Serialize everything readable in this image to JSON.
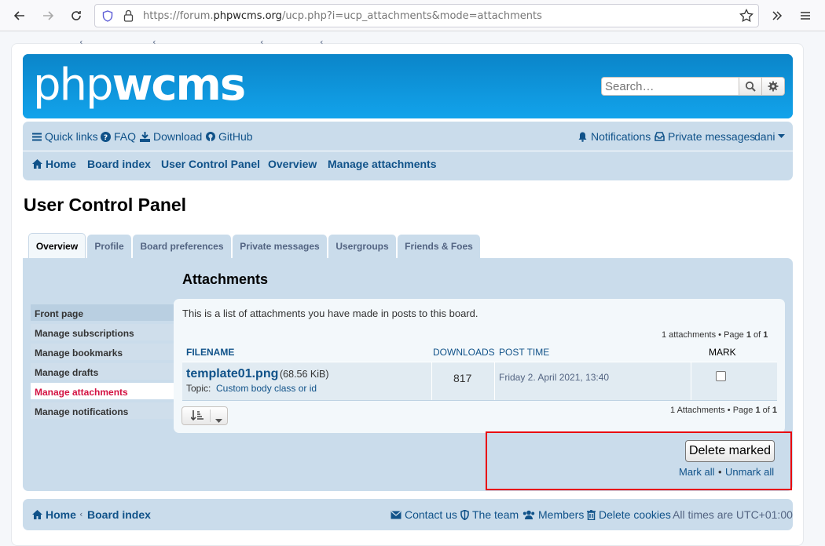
{
  "browser": {
    "url_prefix": "https://forum.",
    "url_domain": "phpwcms.org",
    "url_path": "/ucp.php?i=ucp_attachments&mode=attachments"
  },
  "header": {
    "logo_thin": "php",
    "logo_bold": "wcms",
    "search_placeholder": "Search…"
  },
  "navbar": {
    "quick_links": "Quick links",
    "faq": "FAQ",
    "download": "Download",
    "github": "GitHub",
    "notifications": "Notifications",
    "private_messages": "Private messages",
    "user": "dani",
    "breadcrumbs": [
      "Home",
      "Board index",
      "User Control Panel",
      "Overview",
      "Manage attachments"
    ]
  },
  "page_title": "User Control Panel",
  "tabs": [
    "Overview",
    "Profile",
    "Board preferences",
    "Private messages",
    "Usergroups",
    "Friends & Foes"
  ],
  "sidebar": [
    "Front page",
    "Manage subscriptions",
    "Manage bookmarks",
    "Manage drafts",
    "Manage attachments",
    "Manage notifications"
  ],
  "attachments": {
    "title": "Attachments",
    "intro": "This is a list of attachments you have made in posts to this board.",
    "pagination_top": {
      "count": "1 attachments",
      "page_word": "• Page",
      "page": "1",
      "of_word": "of",
      "total": "1"
    },
    "pagination_bottom": {
      "count": "1 Attachments",
      "page_word": "• Page",
      "page": "1",
      "of_word": "of",
      "total": "1"
    },
    "columns": {
      "filename": "FILENAME",
      "downloads": "DOWNLOADS",
      "post_time": "POST TIME",
      "mark": "MARK"
    },
    "rows": [
      {
        "filename": "template01.png",
        "size": "(68.56 KiB)",
        "topic_label": "Topic:",
        "topic": "Custom body class or id",
        "downloads": "817",
        "post_time": "Friday 2. April 2021, 13:40",
        "marked": false
      }
    ]
  },
  "actions": {
    "delete_marked": "Delete marked",
    "mark_all": "Mark all",
    "separator": "•",
    "unmark_all": "Unmark all"
  },
  "footer": {
    "home": "Home",
    "board_index": "Board index",
    "contact_us": "Contact us",
    "the_team": "The team",
    "members": "Members",
    "delete_cookies": "Delete cookies",
    "timezone": "All times are UTC+01:00"
  },
  "colors": {
    "header_blue": "#12a3eb",
    "nav_bg": "#cadceb",
    "link": "#105289",
    "active_red": "#d31141",
    "highlight_red": "#e8000b"
  }
}
